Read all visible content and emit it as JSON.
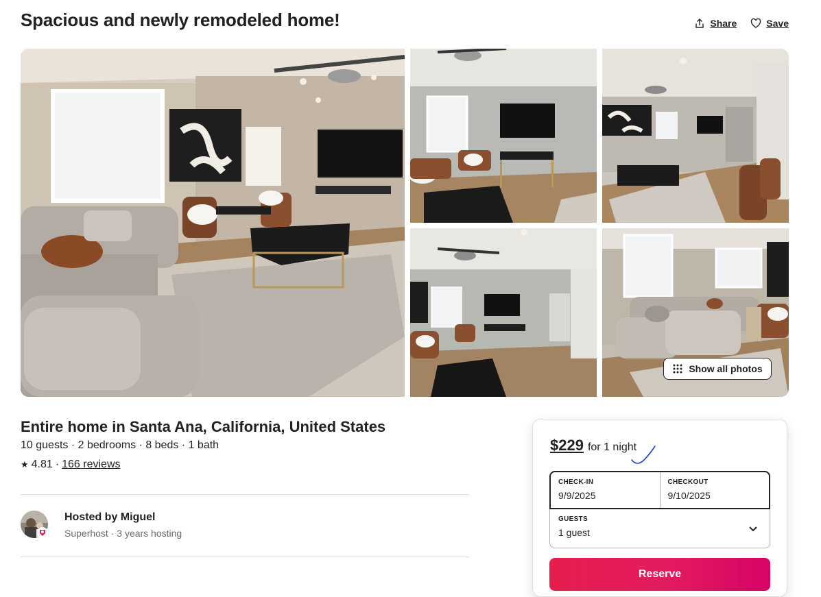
{
  "header": {
    "title": "Spacious and newly remodeled home!",
    "share_label": "Share",
    "save_label": "Save",
    "share_icon": "share-icon",
    "save_icon": "heart-icon"
  },
  "gallery": {
    "show_all_label": "Show all photos",
    "show_all_icon": "grid-dots-icon"
  },
  "listing": {
    "title": "Entire home in Santa Ana, California, United States",
    "specs": "10 guests · 2 bedrooms · 8 beds · 1 bath",
    "star": "★",
    "rating": "4.81",
    "separator": "·",
    "reviews": "166 reviews"
  },
  "host": {
    "name": "Hosted by Miguel",
    "subtitle": "Superhost · 3 years hosting"
  },
  "booking": {
    "price": "$229",
    "per": "for 1 night",
    "checkin_label": "CHECK-IN",
    "checkin_value": "9/9/2025",
    "checkout_label": "CHECKOUT",
    "checkout_value": "9/10/2025",
    "guests_label": "GUESTS",
    "guests_value": "1 guest",
    "reserve_label": "Reserve"
  },
  "colors": {
    "brand": "#e31c5f",
    "text": "#222222",
    "muted": "#6a6a6a",
    "divider": "#dddddd"
  }
}
